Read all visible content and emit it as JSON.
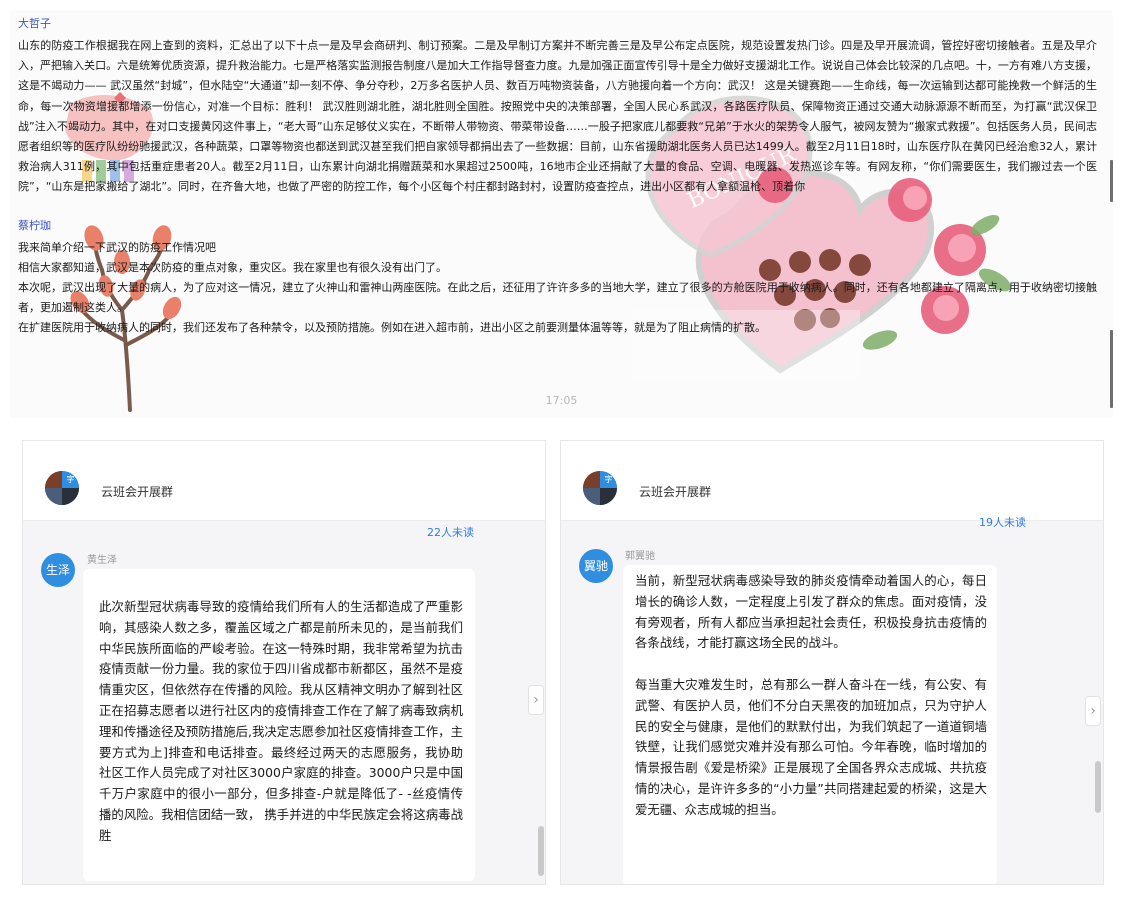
{
  "log": {
    "message1": {
      "sender": "大哲子",
      "text": "山东的防疫工作根据我在网上查到的资料，汇总出了以下十点一是及早会商研判、制订预案。二是及早制订方案并不断完善三是及早公布定点医院，规范设置发热门诊。四是及早开展流调，管控好密切接触者。五是及早介入，严把输入关口。六是统筹优质资源，提升救治能力。七是严格落实监测报告制度八是加大工作指导督查力度。九是加强正面宣传引导十是全力做好支援湖北工作。说说自己体会比较深的几点吧。十，一方有难八方支援，这是不竭动力—— 武汉虽然“封城”，但水陆空“大通道”却一刻不停、争分夺秒，2万多名医护人员、数百万吨物资装备，八方驰援向着一个方向：武汉！ 这是关键赛跑——生命线，每一次运输到达都可能挽救一个鲜活的生命，每一次物资增援都增添一份信心，对准一个目标：胜利！ 武汉胜则湖北胜，湖北胜则全国胜。按照党中央的决策部署，全国人民心系武汉，各路医疗队员、保障物资正通过交通大动脉源源不断而至，为打赢“武汉保卫战”注入不竭动力。其中，在对口支援黄冈这件事上，“老大哥”山东足够仗义实在，不断带人带物资、带菜带设备……一股子把家底儿都要救“兄弟”于水火的架势令人服气，被网友赞为“搬家式救援”。包括医务人员，民间志愿者组织等的医疗队纷纷驰援武汉，各种蔬菜，口罩等物资也都送到武汉甚至我们把自家领导都捐出去了一些数据：目前，山东省援助湖北医务人员已达1499人。截至2月11日18时，山东医疗队在黄冈已经治愈32人，累计救治病人311例，其中包括重症患者20人。截至2月11日，山东累计向湖北捐赠蔬菜和水果超过2500吨，16地市企业还捐献了大量的食品、空调、电暖器、发热巡诊车等。有网友称，“你们需要医生，我们搬过去一个医院”，“山东是把家搬给了湖北”。同时，在齐鲁大地，也做了严密的防控工作，每个小区每个村庄都封路封村，设置防疫查控点，进出小区都有人拿额温枪、顶着你"
    },
    "message2": {
      "sender": "蔡柠珈",
      "lines": [
        "我来简单介绍一下武汉的防疫工作情况吧",
        "相信大家都知道，武汉是本次防疫的重点对象，重灾区。我在家里也有很久没有出门了。",
        "本次呢，武汉出现了大量的病人，为了应对这一情况，建立了火神山和雷神山两座医院。在此之后，还征用了许许多多的当地大学，建立了很多的方舱医院用于收纳病人。同时，还有各地都建立了隔离点，用于收纳密切接触者，更加遏制这类人。",
        "在扩建医院用于收纳病人的同时，我们还发布了各种禁令，以及预防措施。例如在进入超市前，进出小区之前要测量体温等等，就是为了阻止病情的扩散。"
      ]
    },
    "time": "17:05"
  },
  "chat_left": {
    "group_name": "云班会开展群",
    "avatar_badge": "字",
    "unread": "22人未读",
    "avatar_text": "生泽",
    "member_name": "黄生泽",
    "message": "此次新型冠状病毒导致的疫情给我们所有人的生活都造成了严重影响，其感染人数之多，覆盖区域之广都是前所未见的，是当前我们中华民族所面临的严峻考验。在这一特殊时期，我非常希望为抗击疫情贡献一份力量。我的家位于四川省成都市新都区，虽然不是疫情重灾区，但依然存在传播的风险。我从区精神文明办了解到社区正在招募志愿者以进行社区内的疫情排查工作在了解了病毒致病机理和传播途径及预防措施后,我决定志愿参加社区疫情排查工作，主要方式为上]排查和电话排查。最终经过两天的志愿服务，我协助社区工作人员完成了对社区3000户家庭的排查。3000户只是中国千万户家庭中的很小一部分，但多排查-户就是降低了- -丝疫情传播的风险。我相信团结一致， 携手并进的中华民族定会将这病毒战胜"
  },
  "chat_right": {
    "group_name": "云班会开展群",
    "avatar_badge": "字",
    "unread": "19人未读",
    "avatar_text": "翼驰",
    "member_name": "郭翼驰",
    "message_p1": "当前，新型冠状病毒感染导致的肺炎疫情牵动着国人的心，每日增长的确诊人数，一定程度上引发了群众的焦虑。面对疫情，没有旁观者，所有人都应当承担起社会责任，积极投身抗击疫情的各条战线，才能打赢这场全民的战斗。",
    "message_p2": "每当重大灾难发生时，总有那么一群人奋斗在一线，有公安、有武警、有医护人员，他们不分白天黑夜的加班加点，只为守护人民的安全与健康，是他们的默默付出，为我们筑起了一道道铜墙铁壁，让我们感觉灾难并没有那么可怕。今年春晚，临时增加的情景报告剧《爱是桥梁》正是展现了全国各界众志成城、共抗疫情的决心，是许许多多的“小力量”共同搭建起爱的桥梁，这是大爱无疆、众志成城的担当。"
  },
  "sticker_text": "BONJOUR",
  "icons": {
    "arrow": "chevron-right-icon",
    "avatar": "group-avatar-icon"
  },
  "colors": {
    "sender_name": "#3b55c6",
    "unread": "#2f7de1",
    "avatar": "#2f8ee0"
  }
}
